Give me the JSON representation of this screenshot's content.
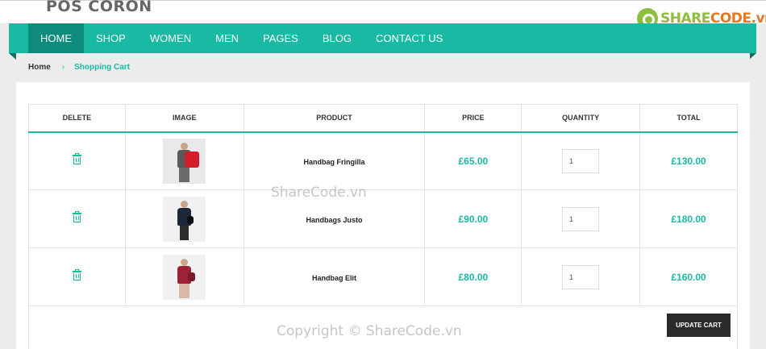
{
  "site": {
    "logo": "POS CORON"
  },
  "watermark_brand": {
    "part1": "SHARE",
    "part2": "CODE.vn"
  },
  "nav": {
    "items": [
      "HOME",
      "SHOP",
      "WOMEN",
      "MEN",
      "PAGES",
      "BLOG",
      "CONTACT US"
    ],
    "active_index": 0
  },
  "breadcrumb": {
    "home": "Home",
    "separator": "›",
    "current": "Shopping Cart"
  },
  "cart": {
    "headers": {
      "delete": "DELETE",
      "image": "IMAGE",
      "product": "PRODUCT",
      "price": "PRICE",
      "quantity": "QUANTITY",
      "total": "TOTAL"
    },
    "rows": [
      {
        "product": "Handbag Fringilla",
        "price": "£65.00",
        "quantity": "1",
        "total": "£130.00"
      },
      {
        "product": "Handbags Justo",
        "price": "£90.00",
        "quantity": "1",
        "total": "£180.00"
      },
      {
        "product": "Handbag Elit",
        "price": "£80.00",
        "quantity": "1",
        "total": "£160.00"
      }
    ],
    "update_label": "UPDATE CART"
  },
  "watermarks": {
    "center": "ShareCode.vn",
    "bottom": "Copyright © ShareCode.vn"
  },
  "colors": {
    "accent": "#1ab9a4",
    "nav_active": "#0e8b7c",
    "button": "#2a2a2a"
  }
}
